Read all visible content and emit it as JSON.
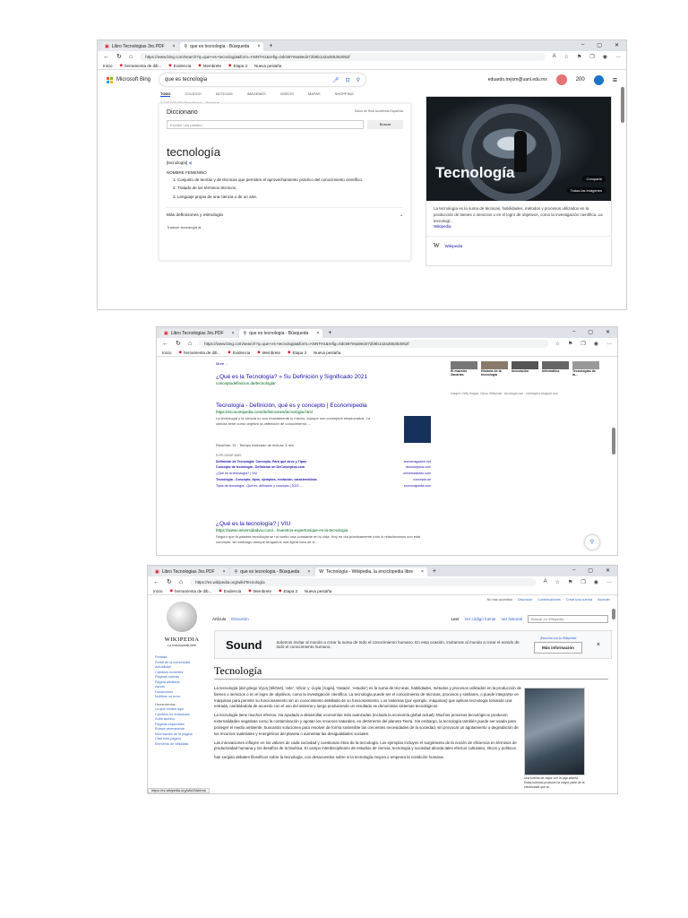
{
  "shot1": {
    "tabs": [
      {
        "label": "Libro Tecnologias 3ro.PDF"
      },
      {
        "label": "que es tecnologia - Búsqueda"
      }
    ],
    "url": "https://www.bing.com/search?q=que+es+tecnologia&form=ANNTH1&refig=0dc587e5a9ed472b9b142a355353052f",
    "favorites": [
      "Inicio",
      "herramienta de dib...",
      "Evidencia",
      "Membrete",
      "Etapa 3",
      "Nueva pestaña"
    ],
    "brand": "Microsoft Bing",
    "query": "que es tecnologia",
    "account": "eduardo.trejom@uanl.edu.mx",
    "points": "200",
    "nav": [
      "TODO",
      "COLEGIO",
      "NOTICIAS",
      "IMÁGENES",
      "VIDEOS",
      "MAPAS",
      "SHOPPING"
    ],
    "results_count": "2,740,000,000 Resultados",
    "date_filter": "Fecha",
    "dict": {
      "title": "Diccionario",
      "source": "Datos de Real Academia Española",
      "placeholder": "Escribe una palabra",
      "button": "Buscar",
      "word": "tecnología",
      "phonetic": "[tecnología]",
      "pos": "NOMBRE FEMENINO",
      "defs": [
        "Conjunto de teorías y de técnicas que permiten el aprovechamiento práctico del conocimiento científico.",
        "Tratado de los términos técnicos.",
        "Lenguaje propio de una ciencia o de un arte."
      ],
      "more": "Más definiciones y etimología",
      "translate": "Traducir tecnología al"
    },
    "panel": {
      "title": "Tecnología",
      "share": "Compartir",
      "all_images": "Todas las imágenes",
      "text": "La tecnología es la suma de técnicas, habilidades, métodos y procesos utilizados en la producción de bienes o servicios o en el logro de objetivos, como la investigación científica. La tecnologí...",
      "source": "Wikipedia",
      "link": "Wikipedia"
    }
  },
  "shot2": {
    "thumbs": [
      "El maestro Zacarías",
      "Historia de la tecnología",
      "Innovación",
      "Informática",
      "Tecnologías de la..."
    ],
    "credits": "Imagen: Getty Images. Datos: Wikipedia · tecnologia.com · merkagena.blogspot.com",
    "more": "More ...",
    "r1": {
      "title": "¿Qué es la Tecnología? » Su Definición y Significado 2021",
      "url": "conceptodefinicion.de/tecnologia/"
    },
    "r2": {
      "title": "Tecnología - Definición, qué es y concepto | Economipedia",
      "url": "https://economipedia.com/definiciones/tecnologia.html",
      "snippet": "La tecnología y la ciencia no son exactamente lo mismo, aunque son conceptos relacionados. La ciencia tiene como objetivo la obtención de conocimiento, ...",
      "meta": "Reseñas: 19 · Tiempo estimado de lectura: 5 min",
      "explore": "EXPLORAR MÁS",
      "links": [
        [
          "Definición de Tecnología: Concepto, Para qué sirve y Tipos",
          "tecnomagazine.net"
        ],
        [
          "Concepto de tecnología - Definición en DeConceptos.com",
          "deconceptos.com"
        ],
        [
          "¿Qué es la tecnología? | VIU",
          "universidadviu.com"
        ],
        [
          "Tecnología - Concepto, tipos, ejemplos, evolución, características",
          "concepto.de"
        ],
        [
          "Tipos de tecnología - Qué es, definición y concepto | 2022 ...",
          "economipedia.com"
        ]
      ]
    },
    "r3": {
      "title": "¿Qué es la tecnología? | VIU",
      "url": "https://www.universidadviu.com/.../nuestros-expertos/que-es-la-tecnologia",
      "snippet": "Seguro que la palabra tecnología se ha vuelto una constante en tu vida. Hoy en día prácticamente todo lo relacionamos con este concepto, sin embargo aunque tengamos una ligera idea de lo ..."
    }
  },
  "shot3": {
    "tab3": "Tecnología - Wikipedia, la enciclopedia libre",
    "url": "https://es.wikipedia.org/wiki/Tecnología",
    "top": [
      "No has accedido",
      "Discusión",
      "Contribuciones",
      "Crear una cuenta",
      "Acceder"
    ],
    "wordmark": "WIKIPEDIA",
    "tagline": "La enciclopedia libre",
    "tabs": [
      "Artículo",
      "Discusión"
    ],
    "actions": [
      "Leer",
      "Ver código fuente",
      "Ver historial"
    ],
    "search": "Buscar en Wikipedia",
    "nav": [
      "Portada",
      "Portal de la comunidad",
      "Actualidad",
      "Cambios recientes",
      "Páginas nuevas",
      "Página aleatoria",
      "Ayuda",
      "Donaciones",
      "Notificar un error",
      "Herramientas",
      "Lo que enlaza aquí",
      "Cambios en enlazadas",
      "Subir archivo",
      "Páginas especiales",
      "Enlace permanente",
      "Información de la página",
      "Citar esta página",
      "Elemento de Wikidata"
    ],
    "banner": {
      "brand": "Sound",
      "text": "Solemos invitar al mundo a crear la suma de todo el conocimiento humano. En esta ocasión, invitamos al mundo a crear el sonido de todo el conocimiento humano.",
      "button": "Más información",
      "small": "¡Escucha con tu Wikipedia!"
    },
    "title": "Tecnología",
    "paras": [
      "La tecnología (del griego τέχνη [tékhnē], 'arte', 'oficio' y -λογία [-logía], 'tratado', 'estudio') es la suma de técnicas, habilidades, métodos y procesos utilizados en la producción de bienes o servicios o en el logro de objetivos, como la investigación científica. La tecnología puede ser el conocimiento de técnicas, procesos y similares, o puede integrarse en máquinas para permitir su funcionamiento sin un conocimiento detallado de su funcionamiento. Los sistemas (por ejemplo, máquinas) que aplican tecnología tomando una entrada, cambiándola de acuerdo con el uso del sistema y luego produciendo un resultado se denominan sistemas tecnológicos.",
      "La tecnología tiene muchos efectos. Ha ayudado a desarrollar economías más avanzadas (incluida la economía global actual). Muchos procesos tecnológicos producen externalidades negativas como la contaminación y agotan los recursos naturales, en detrimento del planeta Tierra. Sin embargo, la tecnología también puede ser usada para proteger el medio ambiente, buscando soluciones para resolver de forma sostenible las crecientes necesidades de la sociedad, sin provocar un agotamiento o degradación de los recursos materiales y energéticos del planeta o aumentar las desigualdades sociales.",
      "Las innovaciones influyen en los valores de cada sociedad y cuestionan ética de la tecnología. Los ejemplos incluyen el surgimiento de la noción de eficiencia en términos de productividad humana y los desafíos de la bioética. El campo interdisciplinario de estudios de ciencia, tecnología y sociedad aborda tales efectos culturales, éticos y políticos."
    ],
    "next_line": "han surgido debates filosóficos sobre la tecnología, con desacuerdos sobre si la tecnología mejora o empeora la condición humana.",
    "caption": "Una turbina de vapor con la caja abierta. Estas turbinas producen la mayor parte de la electricidad que se",
    "status": "https://es.wikipedia.org/wiki/Sistema"
  }
}
